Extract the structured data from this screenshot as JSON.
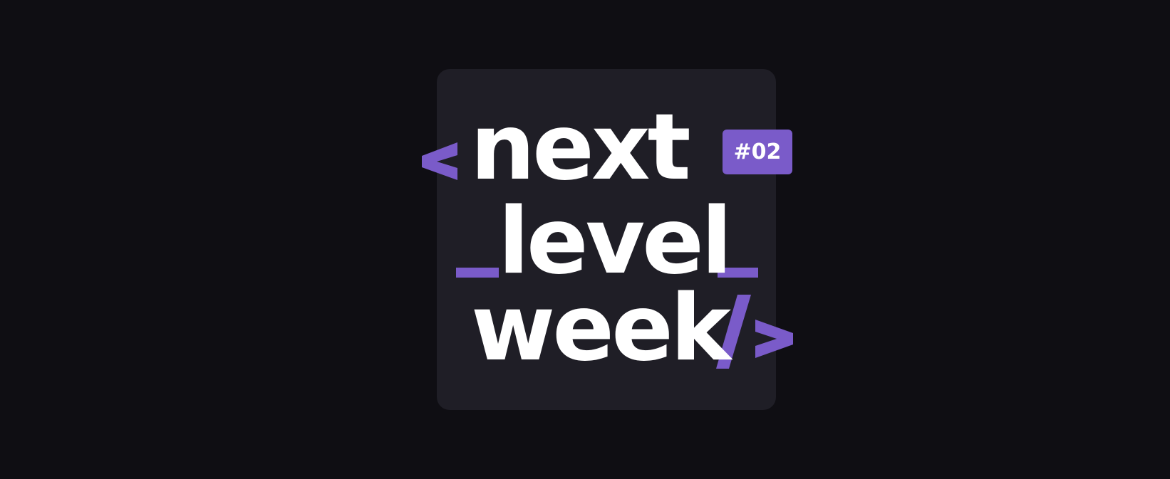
{
  "colors": {
    "background": "#0f0e13",
    "card": "#1f1e26",
    "text": "#ffffff",
    "accent": "#7a5bc9"
  },
  "logo": {
    "word_1": "next",
    "word_2": "level",
    "word_3": "week",
    "badge": "#02",
    "icons": {
      "open_bracket": "angle-bracket-open-icon",
      "left_underscore": "underscore-icon",
      "right_underscore": "underscore-icon",
      "slash": "slash-icon",
      "close_bracket": "angle-bracket-close-icon"
    }
  }
}
